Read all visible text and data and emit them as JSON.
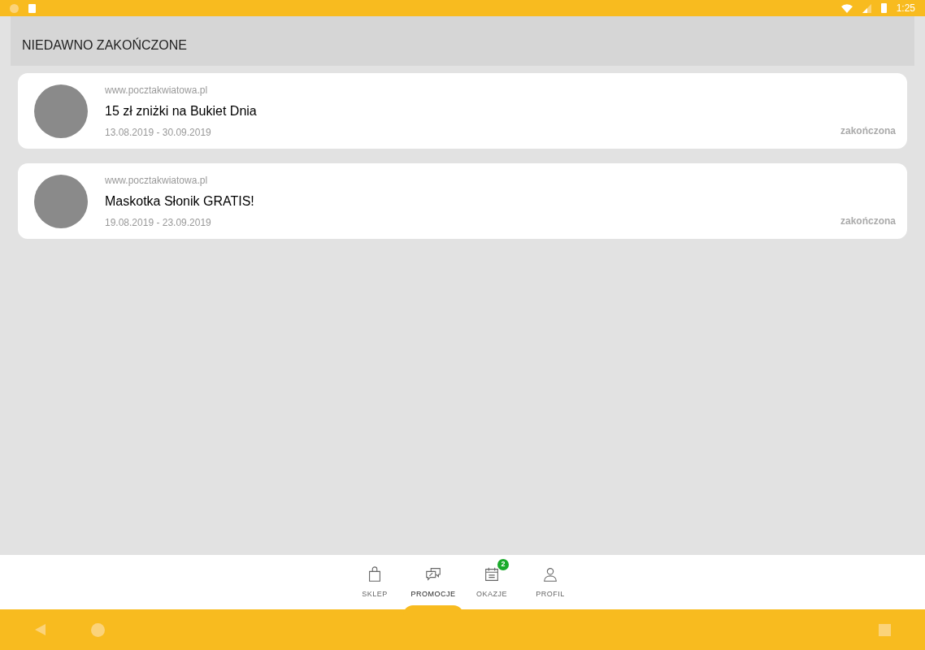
{
  "status_bar": {
    "time": "1:25"
  },
  "section": {
    "title": "NIEDAWNO ZAKOŃCZONE"
  },
  "promotions": [
    {
      "source": "www.pocztakwiatowa.pl",
      "title": "15 zł zniżki na Bukiet Dnia",
      "dates": "13.08.2019 - 30.09.2019",
      "status": "zakończona"
    },
    {
      "source": "www.pocztakwiatowa.pl",
      "title": "Maskotka Słonik GRATIS!",
      "dates": "19.08.2019 - 23.09.2019",
      "status": "zakończona"
    }
  ],
  "bottom_nav": [
    {
      "kind": "bag",
      "label": "SKLEP",
      "selected": false
    },
    {
      "kind": "chat",
      "label": "PROMOCJE",
      "selected": true
    },
    {
      "kind": "calendar",
      "label": "OKAZJE",
      "selected": false,
      "badge": "2"
    },
    {
      "kind": "user",
      "label": "PROFIL",
      "selected": false
    }
  ]
}
